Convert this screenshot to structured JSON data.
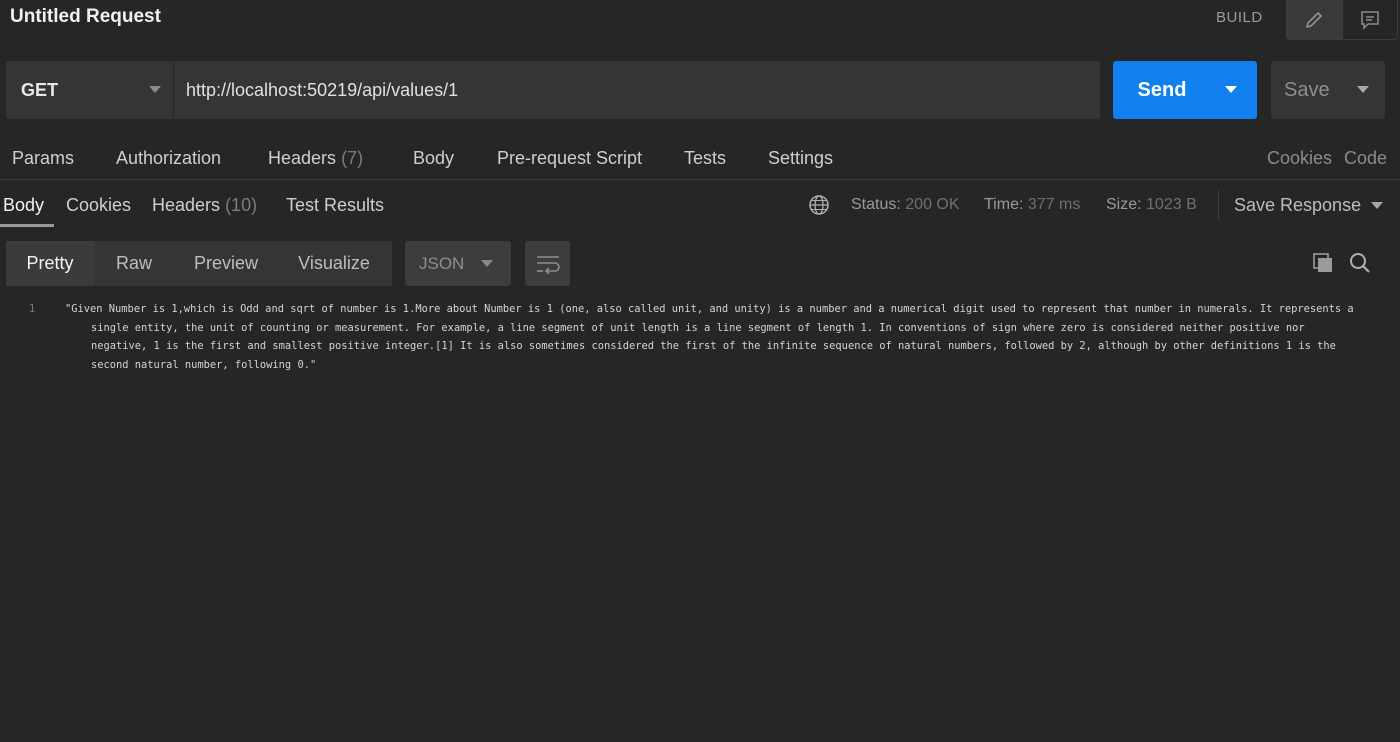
{
  "window": {
    "title": "Untitled Request"
  },
  "mode": {
    "build_label": "BUILD"
  },
  "request": {
    "method": "GET",
    "url": "http://localhost:50219/api/values/1",
    "send_label": "Send",
    "save_label": "Save"
  },
  "request_tabs": [
    {
      "label": "Params"
    },
    {
      "label": "Authorization"
    },
    {
      "label": "Headers",
      "count": "(7)"
    },
    {
      "label": "Body"
    },
    {
      "label": "Pre-request Script"
    },
    {
      "label": "Tests"
    },
    {
      "label": "Settings"
    }
  ],
  "request_links": {
    "cookies": "Cookies",
    "code": "Code"
  },
  "response_tabs": [
    {
      "label": "Body"
    },
    {
      "label": "Cookies"
    },
    {
      "label": "Headers",
      "count": "(10)"
    },
    {
      "label": "Test Results"
    }
  ],
  "response_meta": {
    "status_label": "Status:",
    "status_value": "200 OK",
    "time_label": "Time:",
    "time_value": "377 ms",
    "size_label": "Size:",
    "size_value": "1023 B",
    "save_response": "Save Response"
  },
  "view_modes": [
    "Pretty",
    "Raw",
    "Preview",
    "Visualize"
  ],
  "format": "JSON",
  "response_body": {
    "line_number": "1",
    "text": "\"Given Number is 1,which is Odd and sqrt of number is 1.More about Number is 1 (one, also called unit, and unity) is a number and a numerical digit used to represent that number in numerals. It represents a single entity, the unit of counting or measurement. For example, a line segment of unit length is a line segment of length 1. In conventions of sign where zero is considered neither positive nor negative, 1 is the first and smallest positive integer.[1] It is also sometimes considered the first of the infinite sequence of natural numbers, followed by 2, although by other definitions 1 is the second natural number, following 0.\""
  },
  "icons": {
    "edit": "pencil-icon",
    "comments": "comment-icon",
    "environment": "globe-icon",
    "wrap": "wrap-lines-icon",
    "copy": "copy-icon",
    "search": "search-icon",
    "caret": "chevron-down-icon"
  },
  "colors": {
    "background": "#262626",
    "panel": "#353535",
    "accent": "#0f80ee"
  }
}
